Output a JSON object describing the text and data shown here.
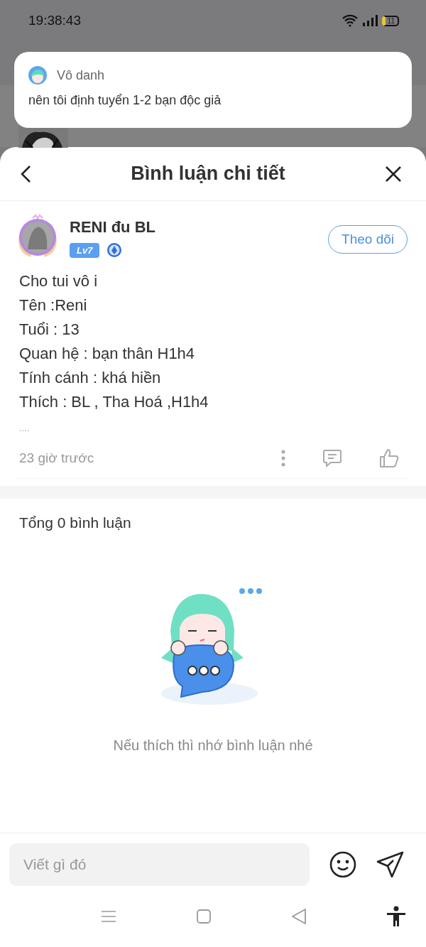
{
  "status_bar": {
    "time": "19:38:43",
    "battery": "11"
  },
  "notification": {
    "sender": "Vô danh",
    "message": "nên tôi định tuyển 1-2 bạn độc giả"
  },
  "header": {
    "title": "Bình luận chi tiết"
  },
  "post": {
    "author": "RENI đu BL",
    "level_badge": "Lv7",
    "follow_button": "Theo dõi",
    "lines": [
      "Cho tui vô i",
      "Tên :Reni",
      "Tuổi : 13",
      "Quan hệ : bạn thân H1h4",
      "Tính cánh : khá hiền",
      "Thích : BL , Tha Hoá ,H1h4"
    ],
    "more": "....",
    "time": "23 giờ trước"
  },
  "comments": {
    "total": "Tổng 0 bình luận",
    "empty_message": "Nếu thích thì nhớ bình luận nhé"
  },
  "composer": {
    "placeholder": "Viết gì đó"
  }
}
